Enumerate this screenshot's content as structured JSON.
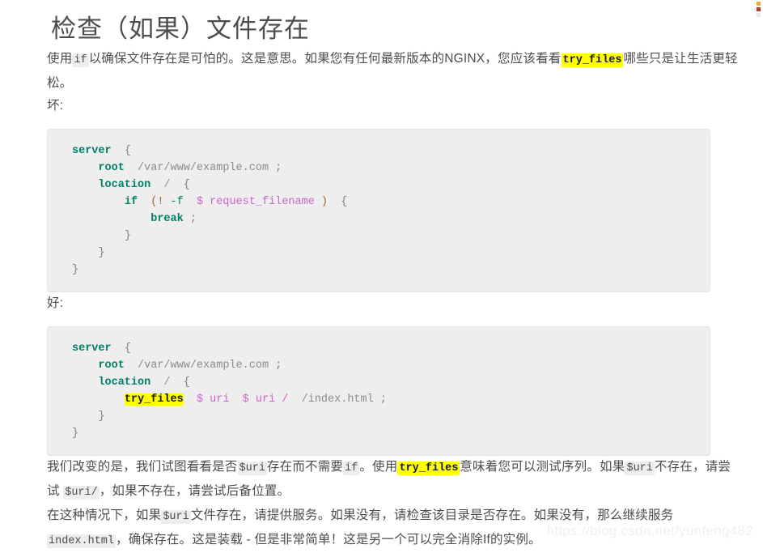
{
  "page": {
    "title": "检查（如果）文件存在",
    "watermark": "https://blog.csdn.net/yunfeng482"
  },
  "intro": {
    "seg1": "使用",
    "code_if": "if",
    "seg2": "以确保文件存在是可怕的。这是意思。如果您有任何最新版本的NGINX，您应该看看",
    "code_try_files": "try_files",
    "seg3": "哪些只是让生活更轻松。"
  },
  "labels": {
    "bad": "坏:",
    "good": "好:"
  },
  "code_bad": {
    "lines": [
      {
        "indent": 0,
        "tokens": [
          {
            "t": "server",
            "c": "kw"
          },
          {
            "t": "  ",
            "c": ""
          },
          {
            "t": "{",
            "c": "pun"
          }
        ]
      },
      {
        "indent": 1,
        "tokens": [
          {
            "t": "root",
            "c": "kw"
          },
          {
            "t": "  ",
            "c": ""
          },
          {
            "t": "/var/www/example.com",
            "c": "path"
          },
          {
            "t": " ",
            "c": ""
          },
          {
            "t": ";",
            "c": "pun"
          }
        ]
      },
      {
        "indent": 1,
        "tokens": [
          {
            "t": "location",
            "c": "kw"
          },
          {
            "t": "  ",
            "c": ""
          },
          {
            "t": "/",
            "c": "path"
          },
          {
            "t": "  ",
            "c": ""
          },
          {
            "t": "{",
            "c": "pun"
          }
        ]
      },
      {
        "indent": 2,
        "tokens": [
          {
            "t": "if",
            "c": "kw"
          },
          {
            "t": "  ",
            "c": ""
          },
          {
            "t": "(",
            "c": "op"
          },
          {
            "t": "!",
            "c": "op"
          },
          {
            "t": " ",
            "c": ""
          },
          {
            "t": "-f",
            "c": "flag"
          },
          {
            "t": "  ",
            "c": ""
          },
          {
            "t": "$",
            "c": "var"
          },
          {
            "t": " ",
            "c": ""
          },
          {
            "t": "request_filename",
            "c": "var"
          },
          {
            "t": " ",
            "c": ""
          },
          {
            "t": ")",
            "c": "op"
          },
          {
            "t": "  ",
            "c": ""
          },
          {
            "t": "{",
            "c": "pun"
          }
        ]
      },
      {
        "indent": 3,
        "tokens": [
          {
            "t": "break",
            "c": "kw"
          },
          {
            "t": " ",
            "c": ""
          },
          {
            "t": ";",
            "c": "pun"
          }
        ]
      },
      {
        "indent": 2,
        "tokens": [
          {
            "t": "}",
            "c": "pun"
          }
        ]
      },
      {
        "indent": 1,
        "tokens": [
          {
            "t": "}",
            "c": "pun"
          }
        ]
      },
      {
        "indent": 0,
        "tokens": [
          {
            "t": "}",
            "c": "pun"
          }
        ]
      }
    ]
  },
  "code_good": {
    "lines": [
      {
        "indent": 0,
        "tokens": [
          {
            "t": "server",
            "c": "kw"
          },
          {
            "t": "  ",
            "c": ""
          },
          {
            "t": "{",
            "c": "pun"
          }
        ]
      },
      {
        "indent": 1,
        "tokens": [
          {
            "t": "root",
            "c": "kw"
          },
          {
            "t": "  ",
            "c": ""
          },
          {
            "t": "/var/www/example.com",
            "c": "path"
          },
          {
            "t": " ",
            "c": ""
          },
          {
            "t": ";",
            "c": "pun"
          }
        ]
      },
      {
        "indent": 1,
        "tokens": [
          {
            "t": "location",
            "c": "kw"
          },
          {
            "t": "  ",
            "c": ""
          },
          {
            "t": "/",
            "c": "path"
          },
          {
            "t": "  ",
            "c": ""
          },
          {
            "t": "{",
            "c": "pun"
          }
        ]
      },
      {
        "indent": 2,
        "tokens": [
          {
            "t": "try_files",
            "c": "mark"
          },
          {
            "t": "  ",
            "c": ""
          },
          {
            "t": "$",
            "c": "var"
          },
          {
            "t": " ",
            "c": ""
          },
          {
            "t": "uri",
            "c": "var"
          },
          {
            "t": "  ",
            "c": ""
          },
          {
            "t": "$",
            "c": "var"
          },
          {
            "t": " ",
            "c": ""
          },
          {
            "t": "uri",
            "c": "var"
          },
          {
            "t": " ",
            "c": ""
          },
          {
            "t": "/",
            "c": "var"
          },
          {
            "t": "  ",
            "c": ""
          },
          {
            "t": "/index.html",
            "c": "path"
          },
          {
            "t": " ",
            "c": ""
          },
          {
            "t": ";",
            "c": "pun"
          }
        ]
      },
      {
        "indent": 1,
        "tokens": [
          {
            "t": "}",
            "c": "pun"
          }
        ]
      },
      {
        "indent": 0,
        "tokens": [
          {
            "t": "}",
            "c": "pun"
          }
        ]
      }
    ]
  },
  "explain1": {
    "seg1": "我们改变的是，我们试图看看是否",
    "code_uri_1": "$uri",
    "seg2": "存在而不需要",
    "code_if": "if",
    "seg3": "。使用",
    "code_try_files": "try_files",
    "seg4": "意味着您可以测试序列。如果",
    "code_uri_2": "$uri",
    "seg5": "不存在，请尝试 ",
    "code_uri_3": "$uri/",
    "seg6": "，如果不存在，请尝试后备位置。"
  },
  "explain2": {
    "seg1": "在这种情况下，如果",
    "code_uri": "$uri",
    "seg2": "文件存在，请提供服务。如果没有，请检查该目录是否存在。如果没有，那么继续服务",
    "code_index": "index.html",
    "seg3": "，确保存在。这是装载 - 但是非常简单！这是另一个可以完全消除If的实例。"
  }
}
